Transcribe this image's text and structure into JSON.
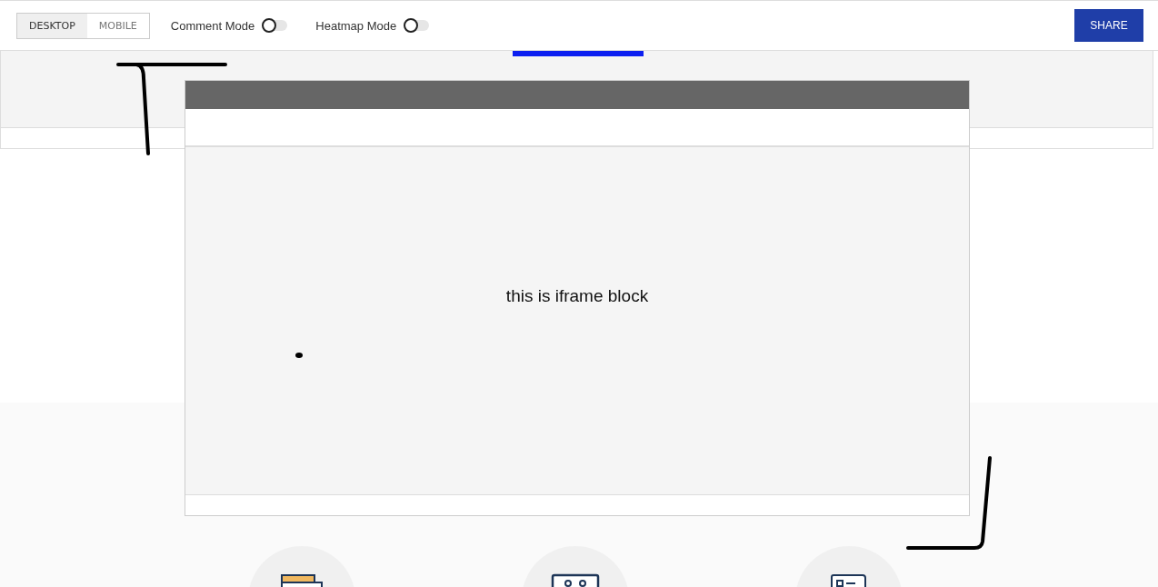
{
  "toolbar": {
    "views": [
      {
        "label": "DESKTOP",
        "selected": true
      },
      {
        "label": "MOBILE",
        "selected": false
      }
    ],
    "toggles": [
      {
        "label": "Comment Mode",
        "on": false
      },
      {
        "label": "Heatmap Mode",
        "on": false
      }
    ],
    "share_button": "SHARE"
  },
  "iframe_block": {
    "text": "this is iframe block"
  },
  "features": [
    {
      "kind": "stack"
    },
    {
      "kind": "tape"
    },
    {
      "kind": "scroll"
    }
  ]
}
